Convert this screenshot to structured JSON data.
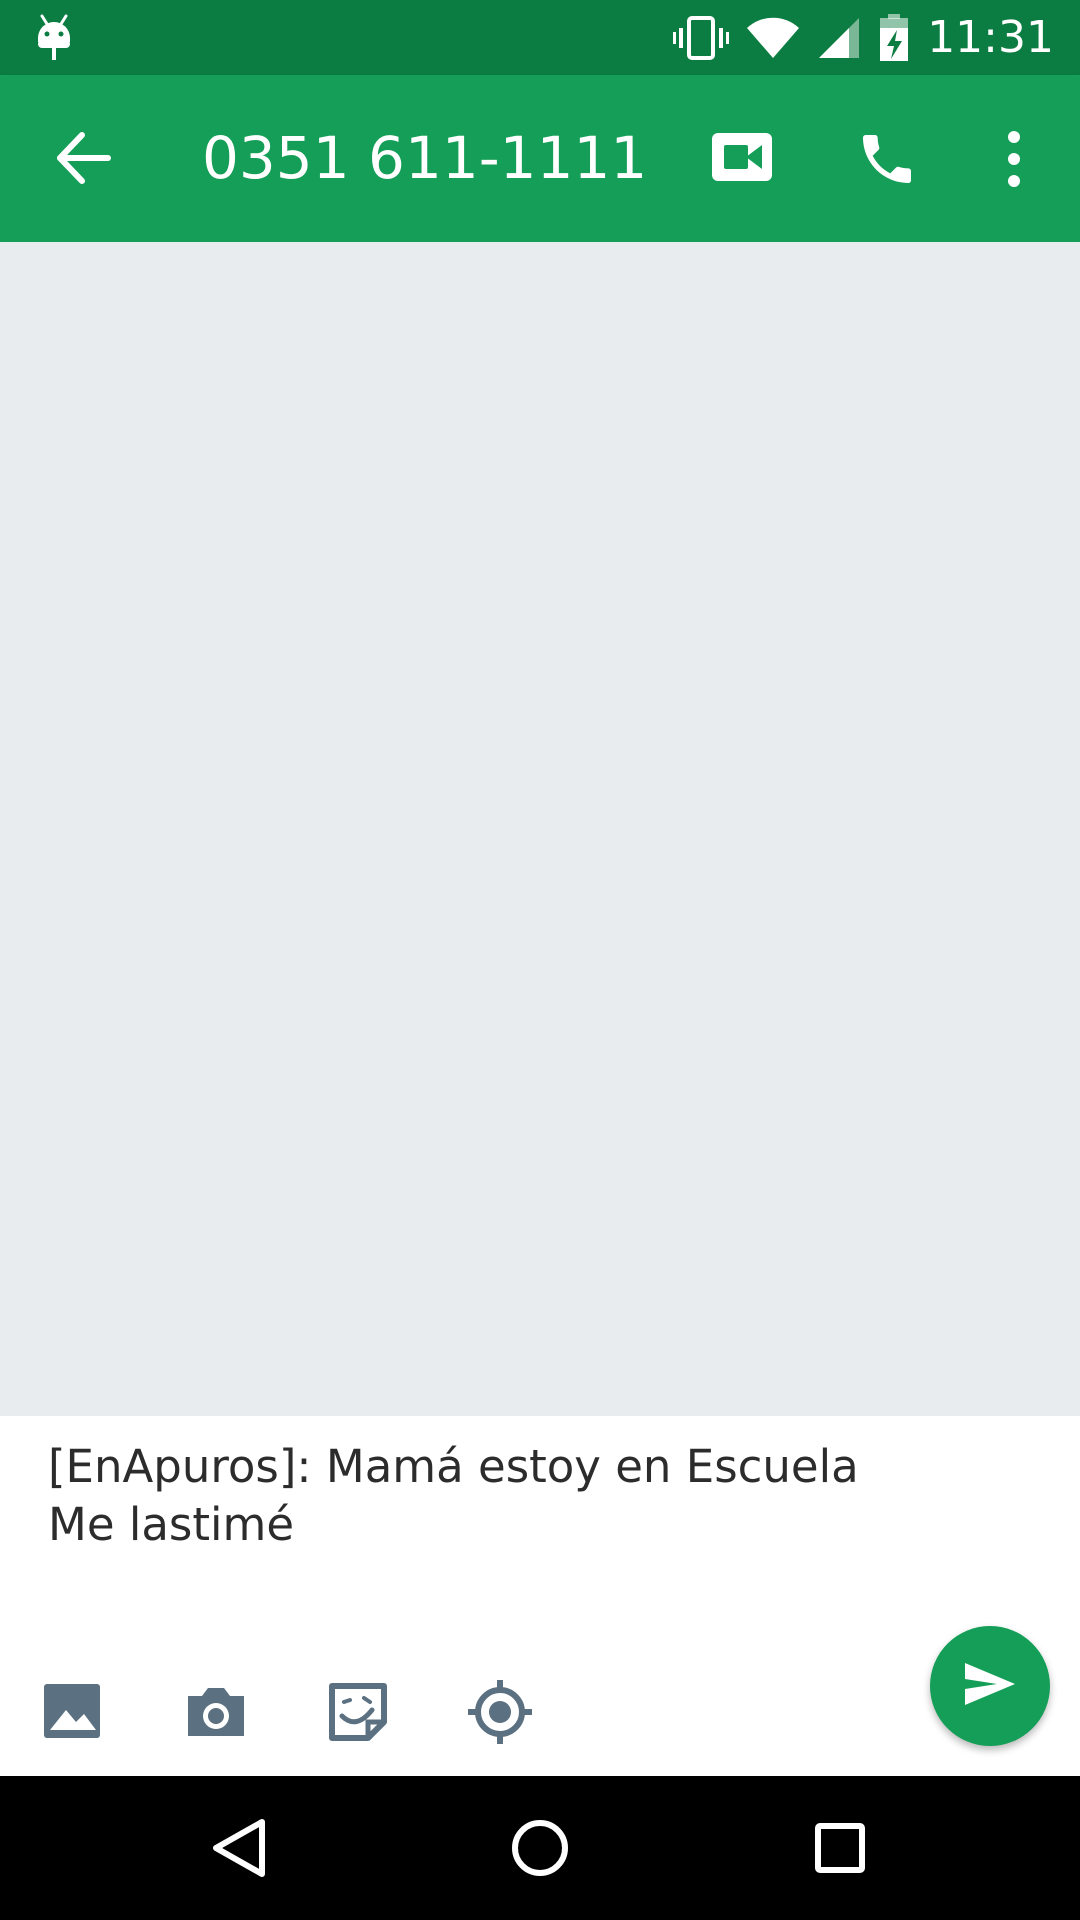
{
  "status_bar": {
    "time": "11:31",
    "icons": [
      "android-debug-icon",
      "vibrate-icon",
      "wifi-icon",
      "signal-icon",
      "battery-charging-icon"
    ],
    "background": "#0c7d42"
  },
  "app_bar": {
    "title": "0351 611-1111",
    "background": "#149e57",
    "icons": [
      "back-arrow-icon",
      "video-call-icon",
      "phone-icon",
      "more-vert-icon"
    ]
  },
  "conversation": {
    "background": "#e8ecef"
  },
  "compose": {
    "message_text": "[EnApuros]: Mamá estoy en Escuela Me lastimé",
    "attachments": [
      "gallery-icon",
      "camera-icon",
      "sticker-icon",
      "location-icon"
    ],
    "send_color": "#149e57"
  },
  "nav_bar": {
    "buttons": [
      "back-nav-icon",
      "home-nav-icon",
      "recents-nav-icon"
    ]
  }
}
